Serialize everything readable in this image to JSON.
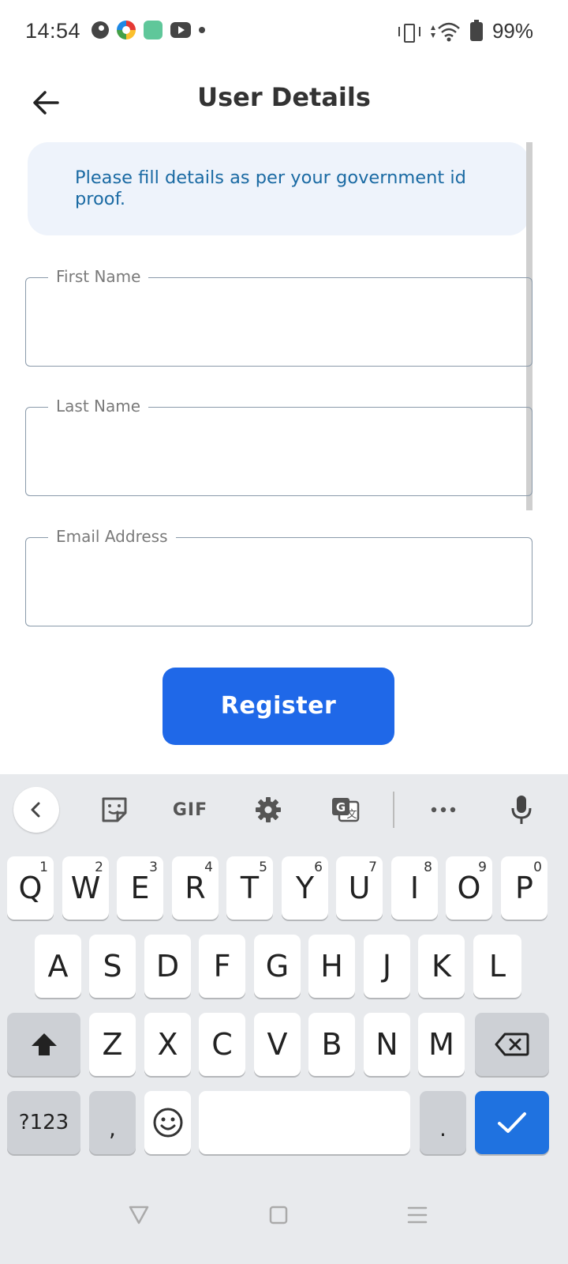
{
  "status_bar": {
    "time": "14:54",
    "battery": "99%",
    "notification_icons": [
      "app-icon",
      "multicolor-app-icon",
      "green-app-icon",
      "youtube-icon",
      "dot-icon"
    ]
  },
  "app_bar": {
    "title": "User Details",
    "back_icon": "arrow-back-icon"
  },
  "info": {
    "text": "Please fill details as per your government id proof."
  },
  "form": {
    "first_name": {
      "label": "First Name",
      "value": ""
    },
    "last_name": {
      "label": "Last Name",
      "value": ""
    },
    "email": {
      "label": "Email Address",
      "value": ""
    },
    "register_label": "Register"
  },
  "colors": {
    "primary": "#1f68e8",
    "info_bg": "#eef3fb",
    "info_text": "#1a6aa3",
    "keyboard_bg": "#e8eaed"
  },
  "keyboard": {
    "toolbar": [
      "chevron-left-icon",
      "sticker-icon",
      "GIF",
      "gear-icon",
      "translate-icon",
      "more-icon",
      "mic-icon"
    ],
    "gif_label": "GIF",
    "row1": [
      {
        "k": "Q",
        "h": "1"
      },
      {
        "k": "W",
        "h": "2"
      },
      {
        "k": "E",
        "h": "3"
      },
      {
        "k": "R",
        "h": "4"
      },
      {
        "k": "T",
        "h": "5"
      },
      {
        "k": "Y",
        "h": "6"
      },
      {
        "k": "U",
        "h": "7"
      },
      {
        "k": "I",
        "h": "8"
      },
      {
        "k": "O",
        "h": "9"
      },
      {
        "k": "P",
        "h": "0"
      }
    ],
    "row2": [
      "A",
      "S",
      "D",
      "F",
      "G",
      "H",
      "J",
      "K",
      "L"
    ],
    "row3": [
      "Z",
      "X",
      "C",
      "V",
      "B",
      "N",
      "M"
    ],
    "symbols_label": "?123",
    "comma": ",",
    "period": "."
  },
  "nav_bar": [
    "back-triangle-icon",
    "home-square-icon",
    "menu-lines-icon"
  ]
}
